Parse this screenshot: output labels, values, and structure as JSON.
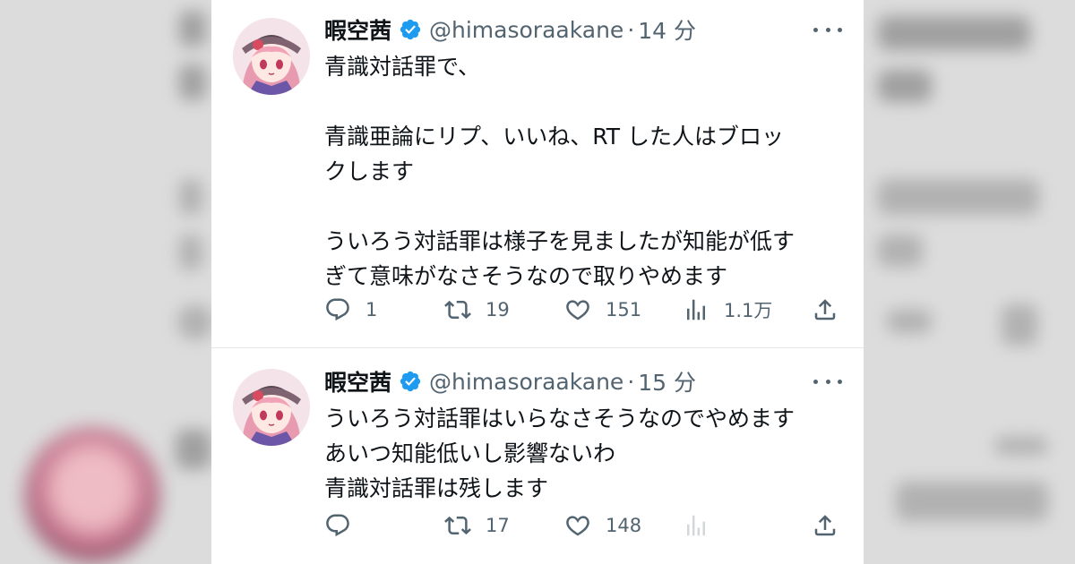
{
  "tweets": [
    {
      "name": "暇空茜",
      "handle": "@himasoraakane",
      "dot": "·",
      "time": "14 分",
      "lines": [
        "青識対話罪で、",
        "",
        "青識亜論にリプ、いいね、RT した人はブロッ",
        "クします",
        "",
        "ういろう対話罪は様子を見ましたが知能が低す",
        "ぎて意味がなさそうなので取りやめます"
      ],
      "replies": "1",
      "retweets": "19",
      "likes": "151",
      "views": "1.1万"
    },
    {
      "name": "暇空茜",
      "handle": "@himasoraakane",
      "dot": "·",
      "time": "15 分",
      "lines": [
        "ういろう対話罪はいらなさそうなのでやめます",
        "あいつ知能低いし影響ないわ",
        "青識対話罪は残します"
      ],
      "replies": "",
      "retweets": "17",
      "likes": "148",
      "views": ""
    }
  ],
  "icons": {
    "verified": "verified-badge-icon",
    "more": "more-icon",
    "reply": "reply-icon",
    "retweet": "retweet-icon",
    "like": "like-icon",
    "views": "views-icon",
    "share": "share-icon"
  },
  "colors": {
    "verified": "#1d9bf0",
    "text": "#0f1419",
    "muted": "#536471"
  }
}
